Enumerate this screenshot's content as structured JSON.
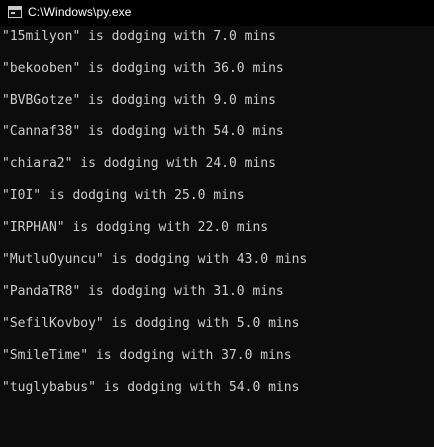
{
  "window": {
    "title": "C:\\Windows\\py.exe",
    "icon": "console-app-icon"
  },
  "console": {
    "lines": [
      "\"15milyon\" is dodging with 7.0 mins",
      "\"bekooben\" is dodging with 36.0 mins",
      "\"BVBGotze\" is dodging with 9.0 mins",
      "\"Cannaf38\" is dodging with 54.0 mins",
      "\"chiara2\" is dodging with 24.0 mins",
      "\"I0I\" is dodging with 25.0 mins",
      "\"IRPHAN\" is dodging with 22.0 mins",
      "\"MutluOyuncu\" is dodging with 43.0 mins",
      "\"PandaTR8\" is dodging with 31.0 mins",
      "\"SefilKovboy\" is dodging with 5.0 mins",
      "\"SmileTime\" is dodging with 37.0 mins",
      "\"tuglybabus\" is dodging with 54.0 mins"
    ]
  },
  "colors": {
    "background": "#0c0c0c",
    "titlebar": "#000000",
    "text": "#cccccc",
    "title_text": "#ffffff"
  }
}
